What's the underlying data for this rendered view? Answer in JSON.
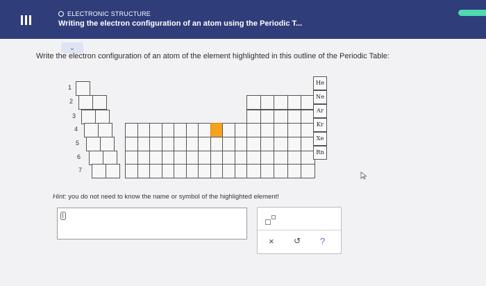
{
  "header": {
    "category": "ELECTRONIC STRUCTURE",
    "title": "Writing the electron configuration of an atom using the Periodic T..."
  },
  "collapse_tab": {
    "icon": "chevron-down-icon",
    "glyph": "⌄"
  },
  "question": "Write the electron configuration of an atom of the element highlighted in this outline of the Periodic Table:",
  "periodic_table": {
    "periods": [
      "1",
      "2",
      "3",
      "4",
      "5",
      "6",
      "7"
    ],
    "noble_gases": [
      "He",
      "Ne",
      "Ar",
      "Kr",
      "Xe",
      "Rn"
    ],
    "highlighted_element": {
      "period": 4,
      "group": 10
    },
    "highlight_color": "#f6a21e"
  },
  "hint": {
    "prefix": "Hint:",
    "text": "you do not need to know the name or symbol of the highlighted element!"
  },
  "answer": {
    "value": ""
  },
  "tools": {
    "superscript_icon": "superscript-icon",
    "clear_label": "×",
    "undo_label": "↺",
    "help_label": "?"
  },
  "colors": {
    "header_bg": "#2f3d7a",
    "accent": "#4fd9b0",
    "help": "#5b6fd0"
  }
}
